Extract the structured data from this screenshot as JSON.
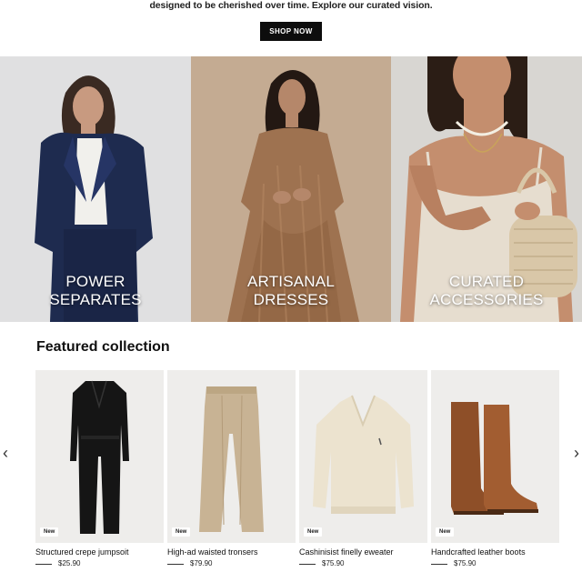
{
  "hero": {
    "tagline": "designed to be cherished over time. Explore our curated vision.",
    "cta_label": "SHOP NOW"
  },
  "categories": [
    {
      "line1": "POWER",
      "line2": "SEPARATES"
    },
    {
      "line1": "ARTISANAL",
      "line2": "DRESSES"
    },
    {
      "line1": "CURATED",
      "line2": "ACCESSORIES"
    }
  ],
  "featured": {
    "title": "Featured collection",
    "products": [
      {
        "badge": "New",
        "name": "Structured crepe jumpsoit",
        "price": "$25.90",
        "icon": "jumpsuit"
      },
      {
        "badge": "New",
        "name": "High-ad waisted tronsers",
        "price": "$79.90",
        "icon": "trousers"
      },
      {
        "badge": "New",
        "name": "Cashinisist finelly eweater",
        "price": "$75.90",
        "icon": "sweater"
      },
      {
        "badge": "New",
        "name": "Handcrafted leather boots",
        "price": "$75.90",
        "icon": "boots"
      }
    ]
  },
  "nav": {
    "prev": "‹",
    "next": "›"
  },
  "colors": {
    "button_bg": "#0d0d0d",
    "tile_bg": "#eeedeb"
  }
}
